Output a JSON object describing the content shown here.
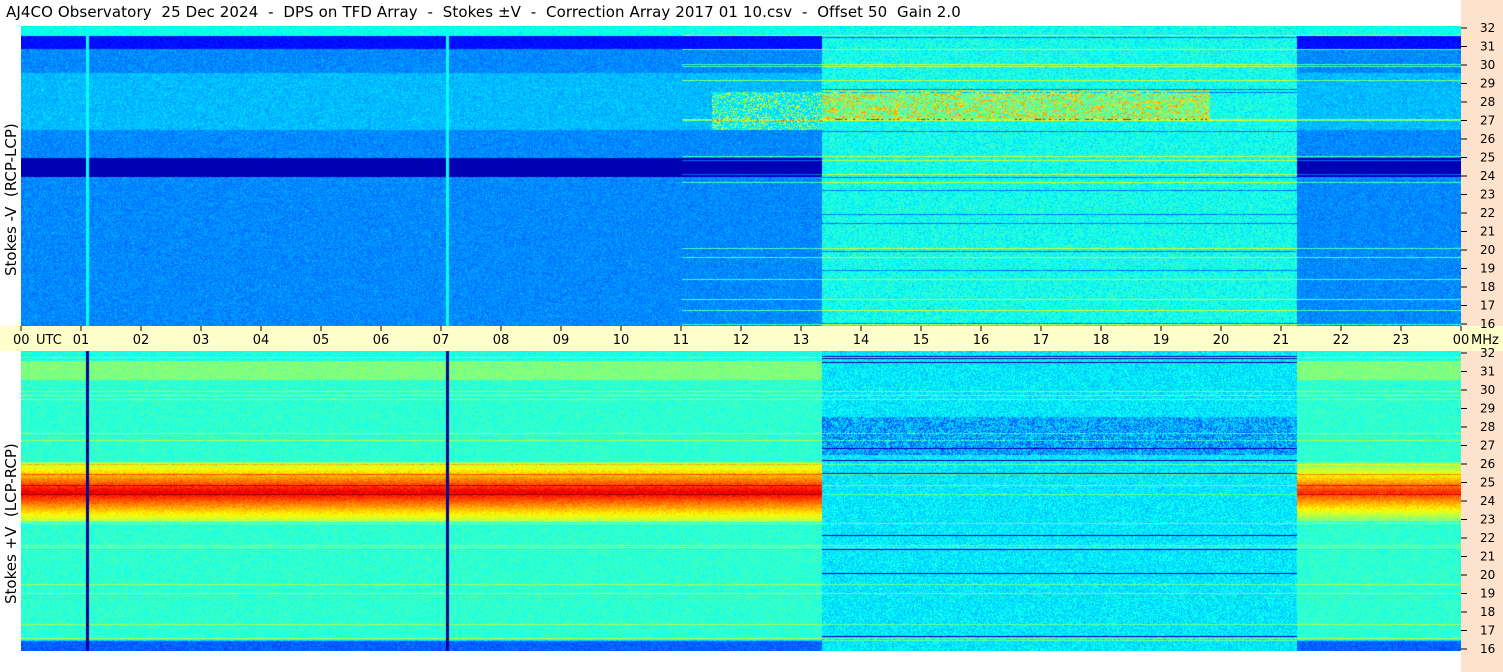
{
  "title": "AJ4CO Observatory  25 Dec 2024  -  DPS on TFD Array  -  Stokes ±V  -  Correction Array 2017 01 10.csv  -  Offset 50  Gain 2.0",
  "chart_data": [
    {
      "type": "heatmap",
      "panel": "top",
      "ylabel": "Stokes -V  (RCP-LCP)",
      "x_unit": "UTC",
      "x_ticks": [
        "00",
        "01",
        "02",
        "03",
        "04",
        "05",
        "06",
        "07",
        "08",
        "09",
        "10",
        "11",
        "12",
        "13",
        "14",
        "15",
        "16",
        "17",
        "18",
        "19",
        "20",
        "21",
        "22",
        "23",
        "00"
      ],
      "x_range": [
        0,
        24
      ],
      "y_unit": "MHz",
      "y_ticks": [
        "16",
        "17",
        "18",
        "19",
        "20",
        "21",
        "22",
        "23",
        "24",
        "25",
        "26",
        "27",
        "28",
        "29",
        "30",
        "31",
        "32"
      ],
      "y_range": [
        16,
        32
      ],
      "colormap": "jet",
      "features": {
        "vertical_lines_utc": [
          1.1,
          7.1
        ],
        "shaded_band_utc": [
          13.35,
          21.25
        ],
        "dark_band_mhz": [
          24.0,
          25.0
        ]
      }
    },
    {
      "type": "heatmap",
      "panel": "bottom",
      "ylabel": "Stokes +V  (LCP-RCP)",
      "x_unit": "UTC",
      "x_range": [
        0,
        24
      ],
      "y_unit": "MHz",
      "y_ticks": [
        "16",
        "17",
        "18",
        "19",
        "20",
        "21",
        "22",
        "23",
        "24",
        "25",
        "26",
        "27",
        "28",
        "29",
        "30",
        "31",
        "32"
      ],
      "y_range": [
        16,
        32
      ],
      "colormap": "jet",
      "features": {
        "vertical_lines_utc": [
          1.1,
          7.1
        ],
        "shaded_band_utc": [
          13.35,
          21.25
        ],
        "bright_band_mhz": [
          24.0,
          25.0
        ]
      }
    }
  ],
  "axis_units": {
    "utc": "UTC",
    "mhz": "MHz"
  },
  "colors": {
    "axis_bar": "#ffffcc",
    "right_strip": "#fde2cd"
  }
}
